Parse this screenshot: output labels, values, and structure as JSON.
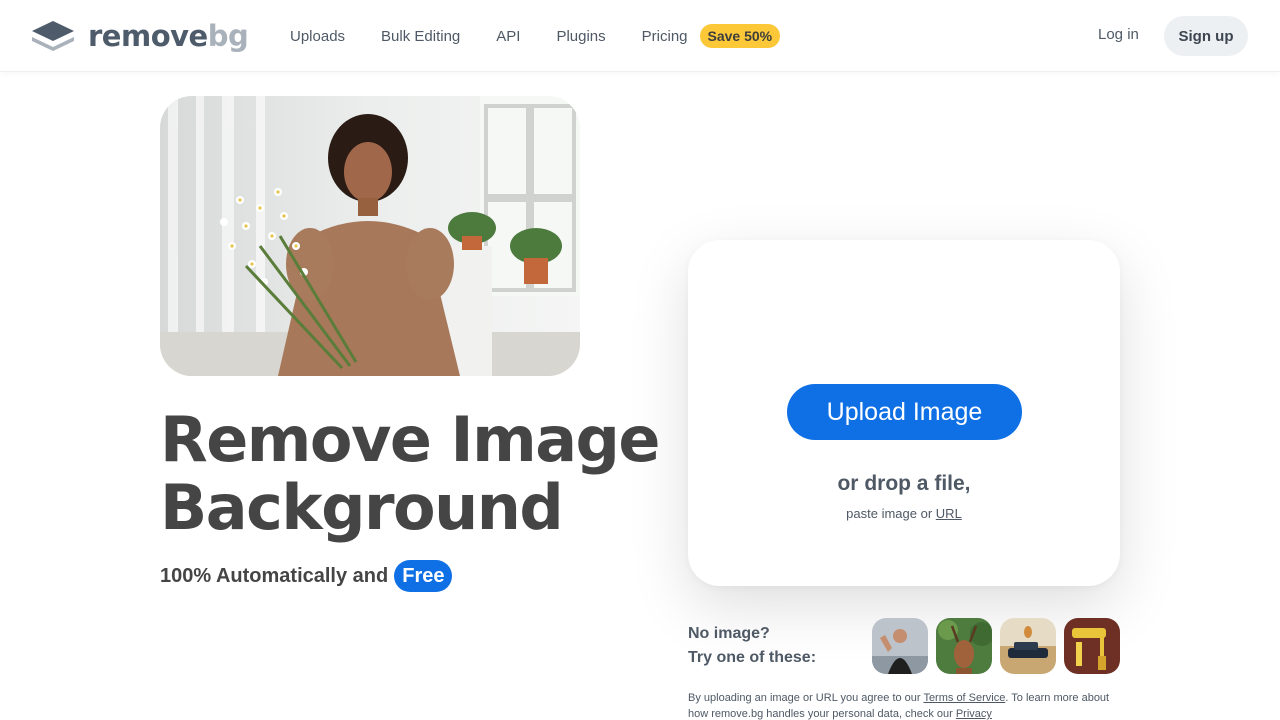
{
  "nav": {
    "logo_remove": "remove",
    "logo_bg": "bg",
    "links": [
      "Uploads",
      "Bulk Editing",
      "API",
      "Plugins",
      "Pricing"
    ],
    "save_badge": "Save 50%",
    "login": "Log in",
    "signup": "Sign up"
  },
  "hero": {
    "title_line1": "Remove Image",
    "title_line2": "Background",
    "subtitle": "100% Automatically and",
    "free_badge": "Free"
  },
  "upload": {
    "button": "Upload Image",
    "drop_text": "or drop a file,",
    "paste_prefix": "paste image or",
    "url_link": "URL"
  },
  "samples": {
    "line1": "No image?",
    "line2": "Try one of these:",
    "thumbs": [
      "woman-flexing-thumbnail",
      "deer-thumbnail",
      "car-thumbnail",
      "paint-roller-thumbnail"
    ]
  },
  "legal": {
    "part1": "By uploading an image or URL you agree to our",
    "terms_link": "Terms of Service",
    "part2": ". To learn more about how remove.bg handles your personal data, check our",
    "privacy_link": "Privacy"
  },
  "colors": {
    "accent": "#0f70e6",
    "badge": "#fcc838",
    "text": "#454545",
    "muted": "#4e5965"
  }
}
